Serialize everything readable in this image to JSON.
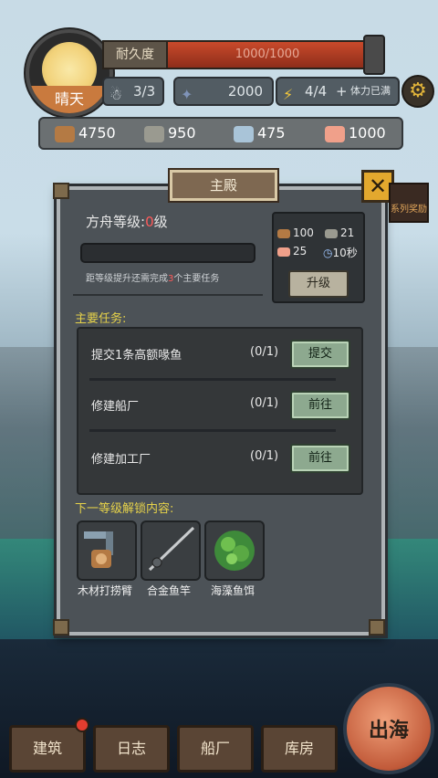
{
  "hud": {
    "weather": "晴天",
    "durability_label": "耐久度",
    "durability_value": "1000/1000",
    "durability_fraction": 1.0,
    "crew": "3/3",
    "coins": "2000",
    "stamina": "4/4",
    "stamina_plus": "+",
    "stamina_status": "体力已满"
  },
  "resources": [
    {
      "name": "wood",
      "value": "4750",
      "color": "#b47a44"
    },
    {
      "name": "stone",
      "value": "950",
      "color": "#9a9a90"
    },
    {
      "name": "iron",
      "value": "475",
      "color": "#a9c4d8"
    },
    {
      "name": "fish",
      "value": "1000",
      "color": "#f0a08a"
    }
  ],
  "panel": {
    "title": "主殿",
    "close": "✕",
    "side_tag": "系列奖励",
    "level_prefix": "方舟等级:",
    "level_num": "0",
    "level_suffix": "级",
    "level_progress": 0.0,
    "hint_prefix": "距等级提升还需完成",
    "hint_num": "3",
    "hint_suffix": "个主要任务",
    "costs": {
      "wood": "100",
      "stone": "21",
      "fish": "25",
      "time": "10秒"
    },
    "upgrade_label": "升级",
    "tasks_label": "主要任务:",
    "tasks": [
      {
        "name": "提交1条高额喙鱼",
        "progress": "(0/1)",
        "button": "提交"
      },
      {
        "name": "修建船厂",
        "progress": "(0/1)",
        "button": "前往"
      },
      {
        "name": "修建加工厂",
        "progress": "(0/1)",
        "button": "前往"
      }
    ],
    "unlock_label": "下一等级解锁内容:",
    "unlocks": [
      {
        "label": "木材打捞臂"
      },
      {
        "label": "合金鱼竿"
      },
      {
        "label": "海藻鱼饵"
      }
    ]
  },
  "nav": {
    "build": "建筑",
    "log": "日志",
    "shipyard": "船厂",
    "warehouse": "库房",
    "sail": "出海"
  }
}
